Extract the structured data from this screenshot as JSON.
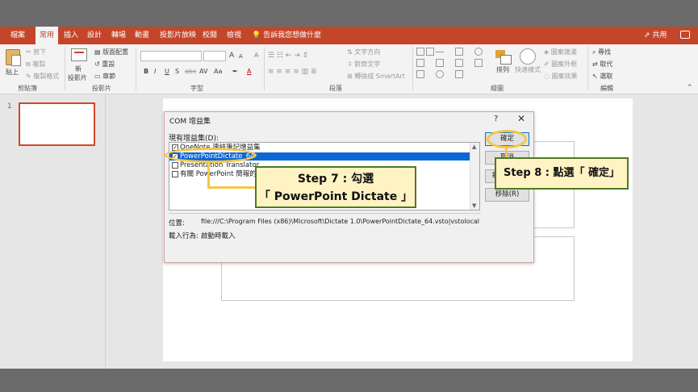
{
  "ribbon_tabs": [
    {
      "label": "檔案",
      "active": false
    },
    {
      "label": "常用",
      "active": true
    },
    {
      "label": "插入",
      "active": false
    },
    {
      "label": "設計",
      "active": false
    },
    {
      "label": "轉場",
      "active": false
    },
    {
      "label": "動畫",
      "active": false
    },
    {
      "label": "投影片放映",
      "active": false
    },
    {
      "label": "校閱",
      "active": false
    },
    {
      "label": "檢視",
      "active": false
    }
  ],
  "tell_me": "告訴我您想做什麼",
  "share": "共用",
  "clipboard": {
    "paste": "貼上",
    "cut": "剪下",
    "copy": "複製",
    "format_painter": "複製格式",
    "group": "剪貼簿"
  },
  "slides": {
    "new_slide_1": "新",
    "new_slide_2": "投影片",
    "layout": "版面配置",
    "reset": "重設",
    "section": "章節",
    "group": "投影片"
  },
  "font": {
    "grow": "A",
    "shrink": "A",
    "bold": "B",
    "italic": "I",
    "underline": "U",
    "shadow": "S",
    "strike": "abc",
    "spacing": "AV",
    "case": "Aa",
    "color": "A",
    "group": "字型"
  },
  "paragraph": {
    "text_direction": "文字方向",
    "align_text": "對齊文字",
    "convert_smartart": "轉換成 SmartArt",
    "group": "段落"
  },
  "drawing": {
    "arrange": "排列",
    "quick_styles": "快速樣式",
    "shape_fill": "圖案填滿",
    "shape_outline": "圖案外框",
    "shape_effects": "圖案效果",
    "group": "繪圖"
  },
  "editing": {
    "find": "尋找",
    "replace": "取代",
    "select": "選取",
    "group": "編輯"
  },
  "slide_number": "1",
  "dialog": {
    "title": "COM 增益集",
    "help": "?",
    "close": "✕",
    "available_label": "現有增益集(D):",
    "addins": [
      {
        "label": "OneNote 連結筆記增益集",
        "checked": true,
        "selected": false
      },
      {
        "label": "PowerPointDictate_64",
        "checked": true,
        "selected": true
      },
      {
        "label": "Presentation Translator",
        "checked": false,
        "selected": false
      },
      {
        "label": "有關 PowerPoint 簡報的 OneNote 筆記",
        "checked": false,
        "selected": false
      }
    ],
    "location_label": "位置:",
    "location_value": "file:///C:\\Program Files (x86)\\Microsoft\\Dictate 1.0\\PowerPointDictate_64.vsto|vstolocal",
    "load_label": "載入行為:",
    "load_value": "啟動時載入",
    "ok": "確定",
    "cancel": "取消",
    "add": "新增(A)...",
    "remove": "移除(R)"
  },
  "callouts": {
    "step7_line1": "Step 7 : 勾選",
    "step7_line2": "「 PowerPoint Dictate 」",
    "step8": "Step 8 : 點選「 確定」"
  },
  "colors": {
    "accent": "#c4462a",
    "highlight": "#f5c646",
    "callout_border": "#4f7a1f",
    "selection": "#0b66d6"
  }
}
